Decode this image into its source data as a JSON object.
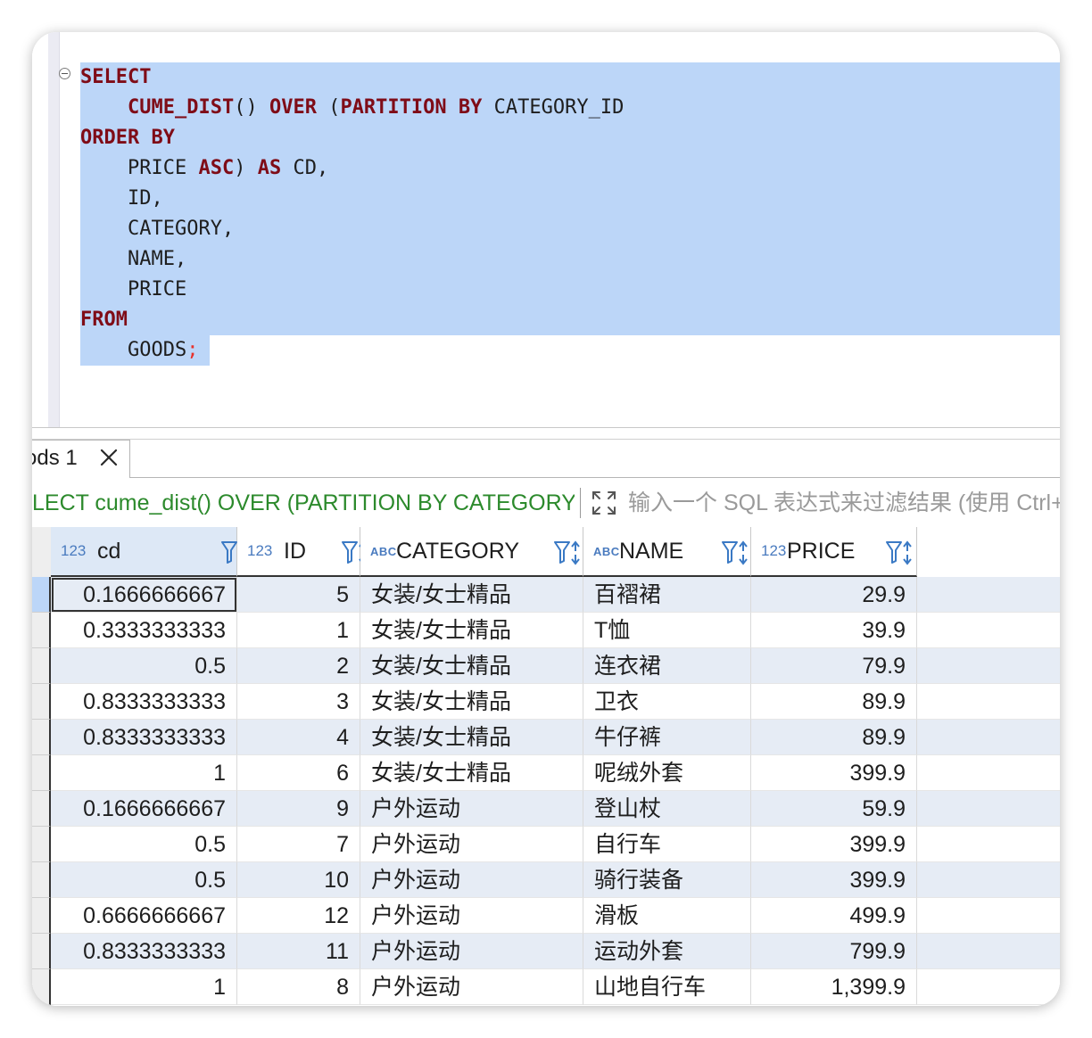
{
  "editor": {
    "lines": [
      [
        {
          "t": "SELECT",
          "k": "kw"
        }
      ],
      [
        {
          "t": "    ",
          "k": "pl"
        },
        {
          "t": "CUME_DIST",
          "k": "kw"
        },
        {
          "t": "() ",
          "k": "pl"
        },
        {
          "t": "OVER",
          "k": "kw"
        },
        {
          "t": " (",
          "k": "pl"
        },
        {
          "t": "PARTITION BY",
          "k": "kw"
        },
        {
          "t": " CATEGORY_ID",
          "k": "pl"
        }
      ],
      [
        {
          "t": "ORDER BY",
          "k": "kw"
        }
      ],
      [
        {
          "t": "    PRICE ",
          "k": "pl"
        },
        {
          "t": "ASC",
          "k": "kw"
        },
        {
          "t": ") ",
          "k": "pl"
        },
        {
          "t": "AS",
          "k": "kw"
        },
        {
          "t": " CD,",
          "k": "pl"
        }
      ],
      [
        {
          "t": "    ID,",
          "k": "pl"
        }
      ],
      [
        {
          "t": "    CATEGORY,",
          "k": "pl"
        }
      ],
      [
        {
          "t": "    NAME,",
          "k": "pl"
        }
      ],
      [
        {
          "t": "    PRICE",
          "k": "pl"
        }
      ],
      [
        {
          "t": "FROM",
          "k": "kw"
        }
      ],
      [
        {
          "t": "    GOODS",
          "k": "pl"
        },
        {
          "t": ";",
          "k": "sc"
        }
      ]
    ]
  },
  "results_tab": {
    "label": "ods 1",
    "close_icon": "close-icon"
  },
  "filter_bar": {
    "sql_text": "LECT cume_dist() OVER (PARTITION BY CATEGORY_ID ORDER BY",
    "placeholder": "输入一个 SQL 表达式来过滤结果 (使用 Ctrl+Space)",
    "expand_icon": "expand-icon"
  },
  "grid": {
    "columns": [
      {
        "type": "123",
        "name": "cd",
        "align": "num"
      },
      {
        "type": "123",
        "name": "ID",
        "align": "num"
      },
      {
        "type": "ABC",
        "name": "CATEGORY",
        "align": "txt"
      },
      {
        "type": "ABC",
        "name": "NAME",
        "align": "txt"
      },
      {
        "type": "123",
        "name": "PRICE",
        "align": "num"
      }
    ],
    "rows": [
      [
        "0.1666666667",
        "5",
        "女装/女士精品",
        "百褶裙",
        "29.9"
      ],
      [
        "0.3333333333",
        "1",
        "女装/女士精品",
        "T恤",
        "39.9"
      ],
      [
        "0.5",
        "2",
        "女装/女士精品",
        "连衣裙",
        "79.9"
      ],
      [
        "0.8333333333",
        "3",
        "女装/女士精品",
        "卫衣",
        "89.9"
      ],
      [
        "0.8333333333",
        "4",
        "女装/女士精品",
        "牛仔裤",
        "89.9"
      ],
      [
        "1",
        "6",
        "女装/女士精品",
        "呢绒外套",
        "399.9"
      ],
      [
        "0.1666666667",
        "9",
        "户外运动",
        "登山杖",
        "59.9"
      ],
      [
        "0.5",
        "7",
        "户外运动",
        "自行车",
        "399.9"
      ],
      [
        "0.5",
        "10",
        "户外运动",
        "骑行装备",
        "399.9"
      ],
      [
        "0.6666666667",
        "12",
        "户外运动",
        "滑板",
        "499.9"
      ],
      [
        "0.8333333333",
        "11",
        "户外运动",
        "运动外套",
        "799.9"
      ],
      [
        "1",
        "8",
        "户外运动",
        "山地自行车",
        "1,399.9"
      ]
    ]
  },
  "colors": {
    "selection": "#bcd6f8",
    "keyword": "#7f0c17",
    "semicolon": "#e8312b",
    "filter_sql": "#2c8a2c",
    "type_badge": "#4a7bbf",
    "alt_row": "#e6ecf5"
  }
}
